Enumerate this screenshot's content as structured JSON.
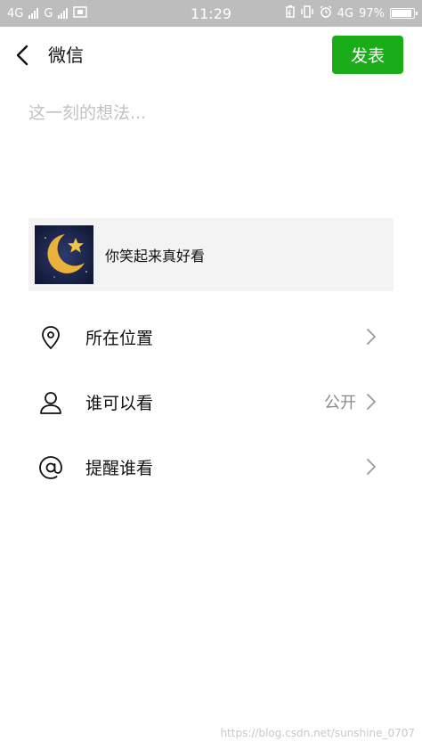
{
  "status_bar": {
    "left_items": [
      "4G",
      "G"
    ],
    "time": "11:29",
    "network": "4G",
    "battery": "97%",
    "battery_level": 0.97
  },
  "header": {
    "title": "微信",
    "publish_label": "发表"
  },
  "composer": {
    "placeholder": "这一刻的想法..."
  },
  "shared_item": {
    "title": "你笑起来真好看"
  },
  "options": {
    "location": {
      "label": "所在位置",
      "icon": "location-pin-icon"
    },
    "visibility": {
      "label": "谁可以看",
      "value": "公开",
      "icon": "person-icon"
    },
    "mention": {
      "label": "提醒谁看",
      "icon": "at-icon"
    }
  },
  "watermark": "https://blog.csdn.net/sunshine_0707",
  "colors": {
    "accent": "#1aad19",
    "status_bar": "#bdbdbd",
    "card_bg": "#f3f3f3"
  }
}
